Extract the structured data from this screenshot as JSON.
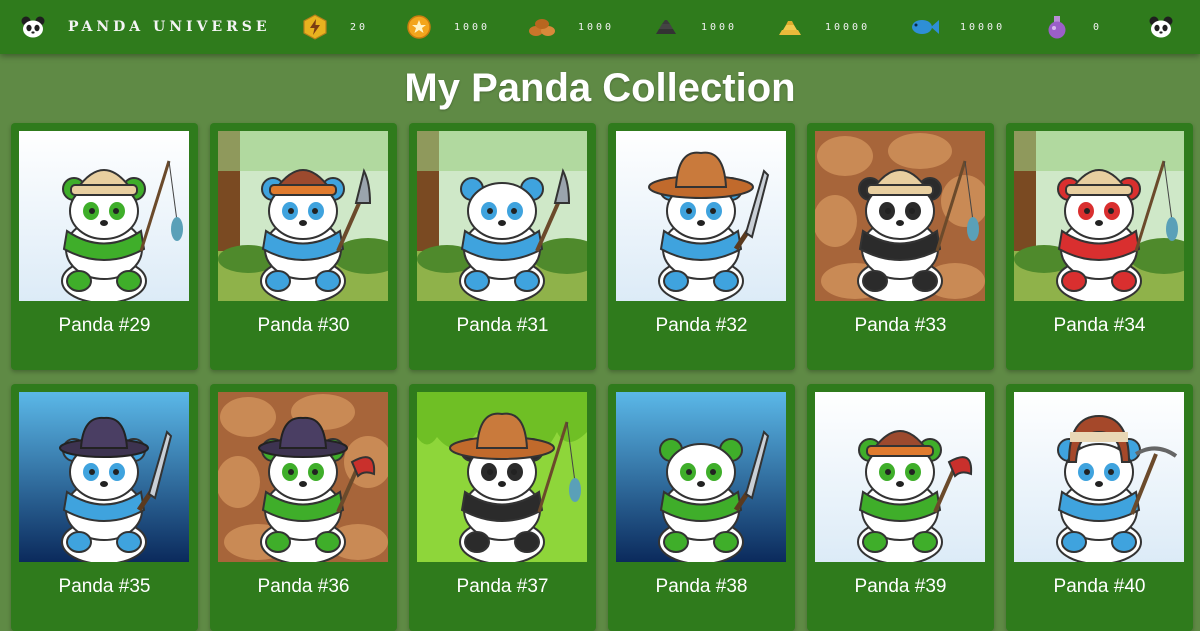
{
  "topbar": {
    "brand_label": "PANDA UNIVERSE",
    "brand_icon": "panda-face-icon",
    "resources": [
      {
        "name": "energy",
        "icon": "lightning-icon",
        "value": "20"
      },
      {
        "name": "coins",
        "icon": "coin-icon",
        "value": "1000"
      },
      {
        "name": "food",
        "icon": "bread-icon",
        "value": "1000"
      },
      {
        "name": "stone",
        "icon": "stone-bricks-icon",
        "value": "1000"
      },
      {
        "name": "gold",
        "icon": "gold-bars-icon",
        "value": "10000"
      },
      {
        "name": "fish",
        "icon": "fish-icon",
        "value": "10000"
      },
      {
        "name": "potion",
        "icon": "potion-icon",
        "value": "0"
      }
    ],
    "profile_icon": "panda-face-icon"
  },
  "page_title": "My Panda Collection",
  "pandas": [
    {
      "name": "Panda #29",
      "background": "light",
      "color": "#3fae2a",
      "hat": "cap-beige",
      "item": "fishing-rod"
    },
    {
      "name": "Panda #30",
      "background": "forest",
      "color": "#3fa3de",
      "hat": "cap-brown",
      "item": "shovel"
    },
    {
      "name": "Panda #31",
      "background": "forest",
      "color": "#3fa3de",
      "hat": "none",
      "item": "shovel"
    },
    {
      "name": "Panda #32",
      "background": "light",
      "color": "#3fa3de",
      "hat": "cowboy",
      "item": "sword"
    },
    {
      "name": "Panda #33",
      "background": "stone",
      "color": "#2b2b2b",
      "hat": "cap-beige",
      "item": "fishing-rod"
    },
    {
      "name": "Panda #34",
      "background": "forest",
      "color": "#d92f2f",
      "hat": "cap-beige",
      "item": "fishing-rod"
    },
    {
      "name": "Panda #35",
      "background": "water",
      "color": "#3fa3de",
      "hat": "fedora",
      "item": "sword"
    },
    {
      "name": "Panda #36",
      "background": "stone",
      "color": "#3fae2a",
      "hat": "fedora",
      "item": "axe"
    },
    {
      "name": "Panda #37",
      "background": "slime",
      "color": "#2b2b2b",
      "hat": "cowboy",
      "item": "fishing-rod"
    },
    {
      "name": "Panda #38",
      "background": "water",
      "color": "#3fae2a",
      "hat": "none",
      "item": "sword"
    },
    {
      "name": "Panda #39",
      "background": "light",
      "color": "#3fae2a",
      "hat": "cap-brown",
      "item": "axe"
    },
    {
      "name": "Panda #40",
      "background": "light",
      "color": "#3fa3de",
      "hat": "ushanka",
      "item": "pickaxe"
    }
  ]
}
